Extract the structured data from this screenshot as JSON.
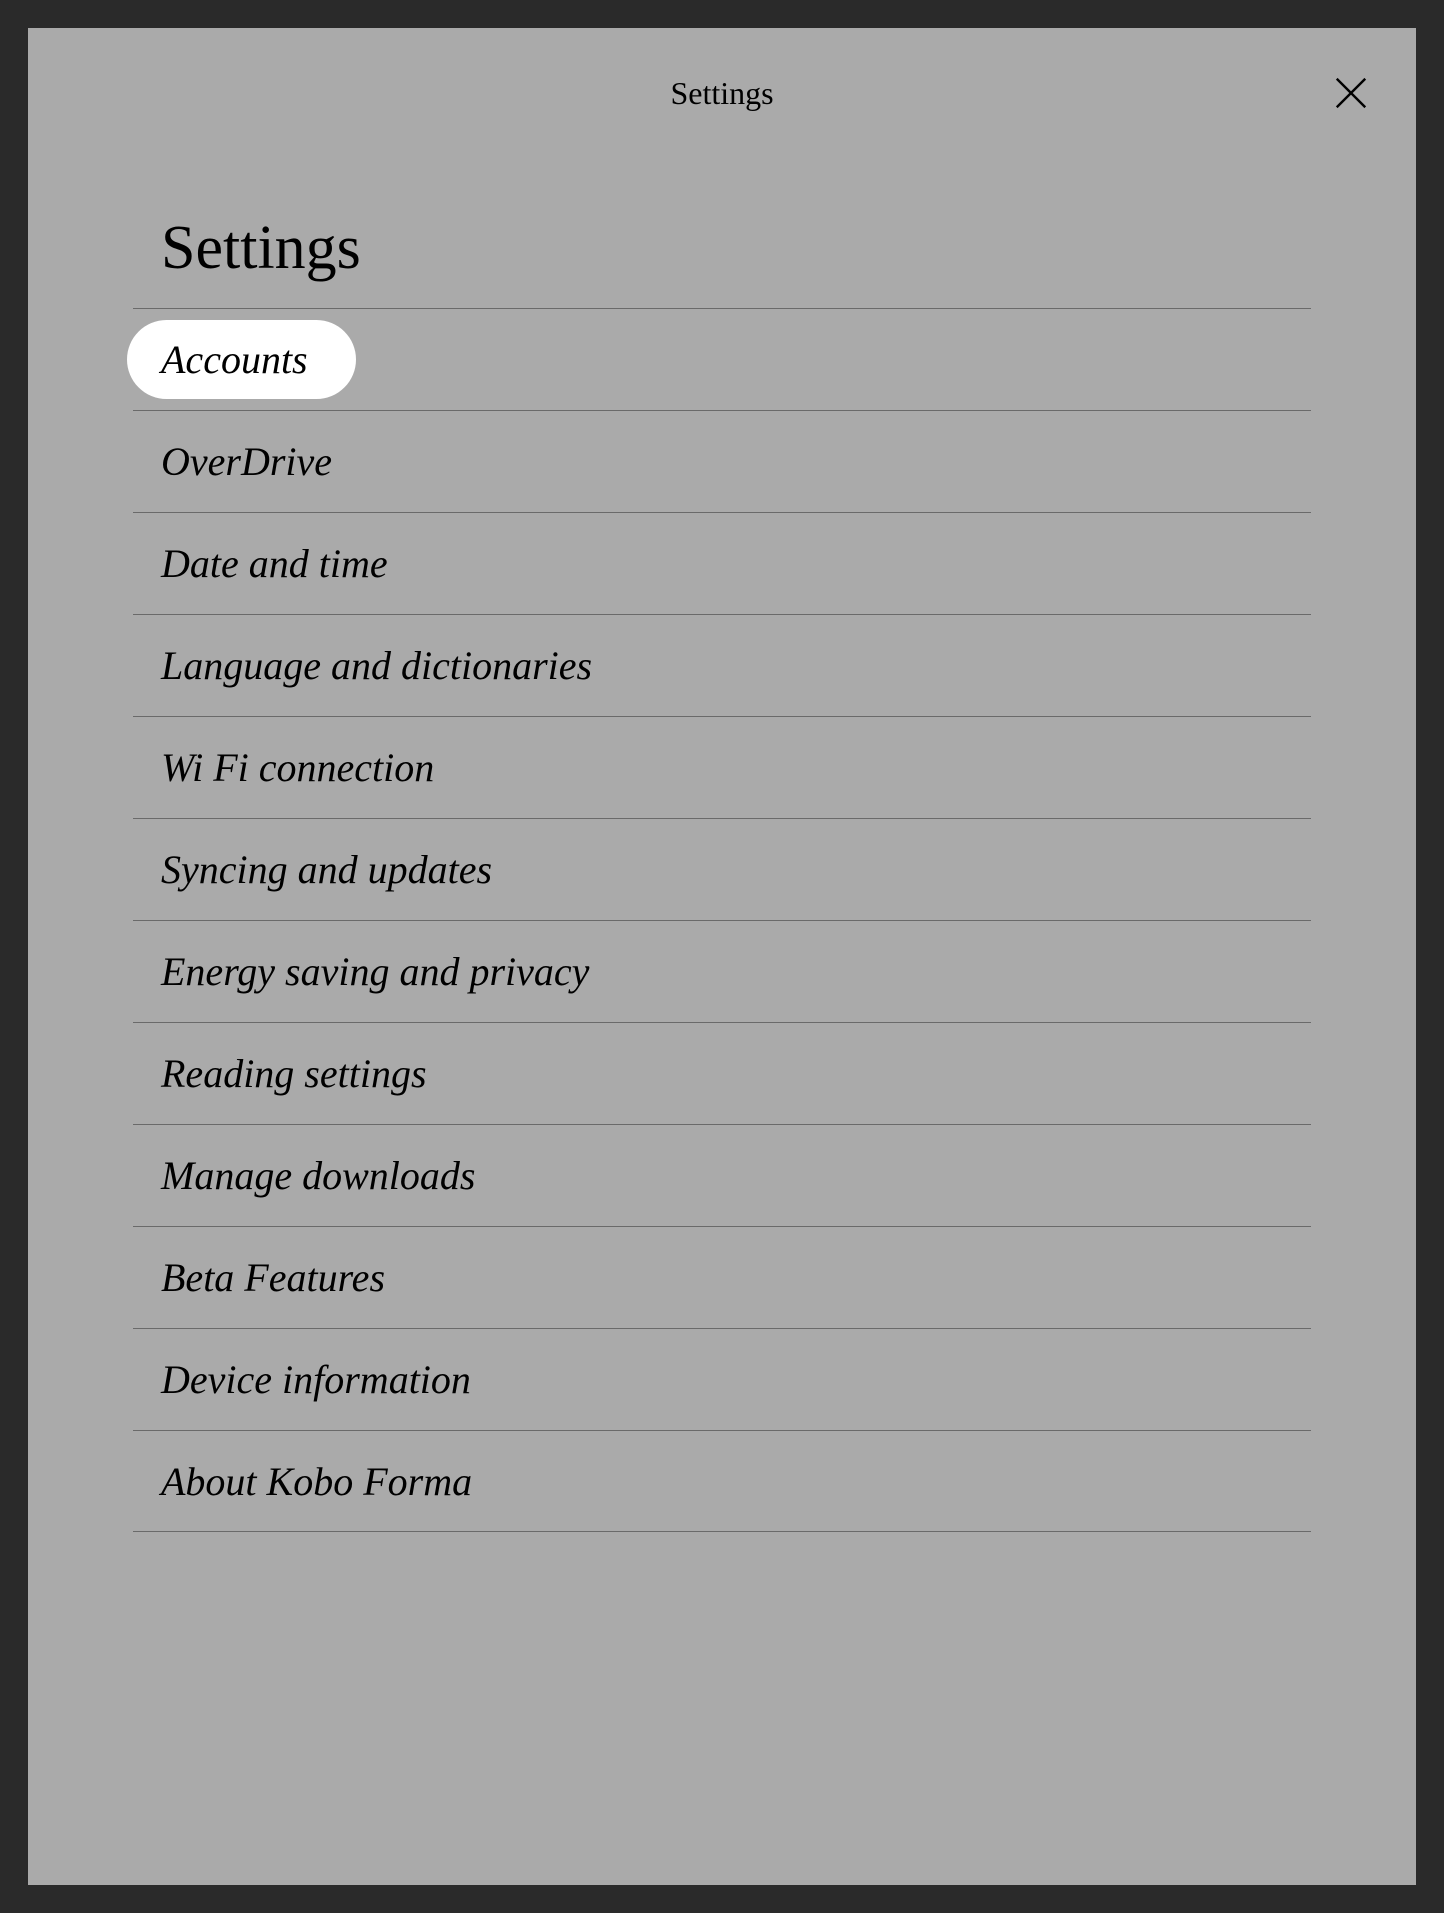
{
  "header": {
    "title": "Settings"
  },
  "page": {
    "title": "Settings"
  },
  "menu": {
    "items": [
      {
        "label": "Accounts",
        "highlighted": true
      },
      {
        "label": "OverDrive",
        "highlighted": false
      },
      {
        "label": "Date and time",
        "highlighted": false
      },
      {
        "label": "Language and dictionaries",
        "highlighted": false
      },
      {
        "label": "Wi Fi connection",
        "highlighted": false
      },
      {
        "label": "Syncing and updates",
        "highlighted": false
      },
      {
        "label": "Energy saving and privacy",
        "highlighted": false
      },
      {
        "label": "Reading settings",
        "highlighted": false
      },
      {
        "label": "Manage downloads",
        "highlighted": false
      },
      {
        "label": "Beta Features",
        "highlighted": false
      },
      {
        "label": "Device information",
        "highlighted": false
      },
      {
        "label": "About Kobo Forma",
        "highlighted": false
      }
    ]
  }
}
